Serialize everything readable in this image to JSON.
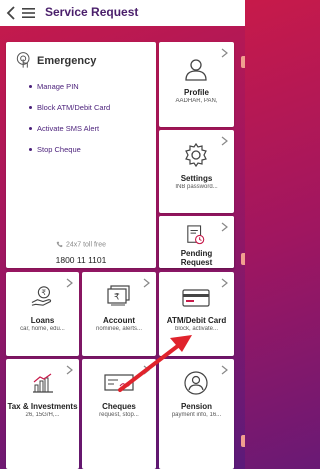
{
  "header": {
    "title": "Service Request"
  },
  "emergency": {
    "title": "Emergency",
    "items": [
      "Manage PIN",
      "Block ATM/Debit Card",
      "Activate SMS Alert",
      "Stop Cheque"
    ],
    "tollfree_label": "24x7 toll free",
    "tollfree_number": "1800 11 1101"
  },
  "tiles": {
    "profile": {
      "name": "Profile",
      "sub": "AADHAR, PAN,"
    },
    "settings": {
      "name": "Settings",
      "sub": "INB password..."
    },
    "pending": {
      "name_line1": "Pending",
      "name_line2": "Request"
    },
    "loans": {
      "name": "Loans",
      "sub": "car, home, edu..."
    },
    "account": {
      "name": "Account",
      "sub": "nominee, alerts..."
    },
    "atm": {
      "name": "ATM/Debit Card",
      "sub": "block, activate..."
    },
    "tax": {
      "name": "Tax & Investments",
      "sub": "26, 15G/H,..."
    },
    "cheques": {
      "name": "Cheques",
      "sub": "request, stop..."
    },
    "pension": {
      "name": "Pension",
      "sub": "payment info, 16..."
    }
  },
  "colors": {
    "brand_purple": "#4a1f6b",
    "gradient_top": "#c71a4a",
    "gradient_bottom": "#5b1a7a",
    "arrow_red": "#e0232c"
  }
}
